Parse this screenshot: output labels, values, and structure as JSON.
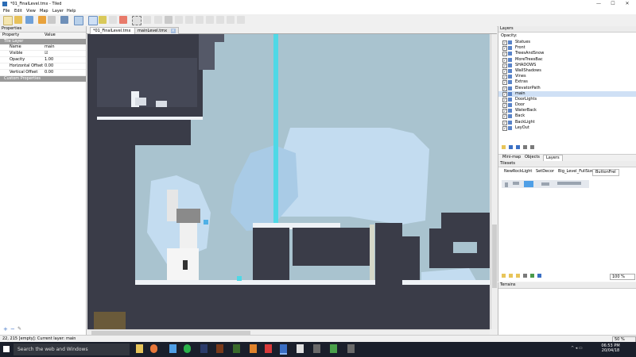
{
  "window": {
    "title": "*01_FinalLevel.tmx - Tiled",
    "controls": [
      "—",
      "☐",
      "✕"
    ]
  },
  "menu": [
    "File",
    "Edit",
    "View",
    "Map",
    "Layer",
    "Help"
  ],
  "tabs": [
    {
      "label": "*01_FinalLevel.tmx",
      "active": true
    },
    {
      "label": "mainLevel.tmx",
      "active": false
    }
  ],
  "properties": {
    "panel_title": "Properties",
    "col_property": "Property",
    "col_value": "Value",
    "group_tile_layer": "Tile Layer",
    "rows": [
      {
        "key": "Name",
        "value": "main"
      },
      {
        "key": "Visible",
        "value": "☑"
      },
      {
        "key": "Opacity",
        "value": "1.00"
      },
      {
        "key": "Horizontal Offset",
        "value": "0.00"
      },
      {
        "key": "Vertical Offset",
        "value": "0.00"
      }
    ],
    "group_custom": "Custom Properties"
  },
  "layers": {
    "panel_title": "Layers",
    "opacity_label": "Opacity:",
    "items": [
      "Statues",
      "Front",
      "TreesAndSnow",
      "MoreTreesBac",
      "SHADOWS",
      "WallShadows",
      "Vines",
      "Extras",
      "ElevatorPath",
      "main",
      "DoorLights",
      "Door",
      "WaterBack",
      "Back",
      "BackLight",
      "LeyOut"
    ],
    "selected": "main",
    "bottom_tabs": [
      "Mini-map",
      "Objects",
      "Layers"
    ]
  },
  "tilesets": {
    "panel_title": "Tilesets",
    "tabs": [
      "NewRockLight",
      "SetDecor",
      "Big_Level_FullSize",
      "ButtonFrel"
    ],
    "zoom": "100 %"
  },
  "terrains": {
    "panel_title": "Terrains",
    "zoom": "50 %"
  },
  "status": {
    "text": "22, 215 [empty]: Current layer: main"
  },
  "taskbar": {
    "search_placeholder": "Search the web and Windows",
    "time": "06:53 PM",
    "date": "20/04/18"
  },
  "colors": {
    "map_dark": "#3a3c48",
    "sky": "#a9c3cf",
    "ice": "#c3dcf0",
    "accent": "#4fd8e6",
    "selection": "#cfe0f5"
  }
}
